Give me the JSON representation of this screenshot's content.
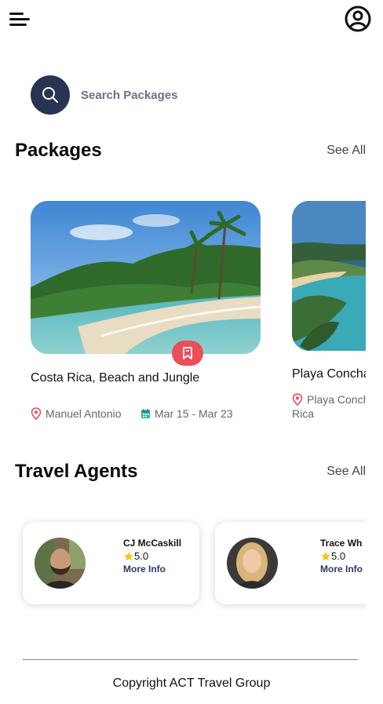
{
  "search": {
    "label": "Search Packages"
  },
  "packages": {
    "title": "Packages",
    "see_all": "See All",
    "items": [
      {
        "title": "Costa Rica, Beach and Jungle",
        "location": "Manuel Antonio",
        "dates": "Mar 15 - Mar 23"
      },
      {
        "title": "Playa Conchal",
        "location_line1": "Playa Conchal",
        "location_line2": "Rica"
      }
    ]
  },
  "agents": {
    "title": "Travel Agents",
    "see_all": "See All",
    "items": [
      {
        "name": "CJ McCaskill",
        "rating": "5.0",
        "more": "More Info"
      },
      {
        "name": "Trace Wh",
        "rating": "5.0",
        "more": "More Info"
      }
    ]
  },
  "footer": {
    "copyright": "Copyright ACT Travel Group"
  },
  "colors": {
    "accent": "#283452",
    "bookmark": "#ec4d57",
    "location_pin": "#ec4d57",
    "calendar": "#2bb3a8",
    "star": "#f5c518"
  }
}
